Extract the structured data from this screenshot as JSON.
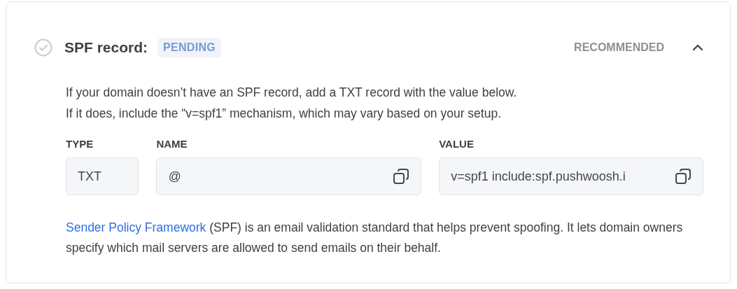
{
  "record": {
    "title": "SPF record:",
    "status": "PENDING",
    "verified": false,
    "tag": "RECOMMENDED",
    "expanded": true
  },
  "description": [
    "If your domain doesn’t have an SPF record, add a TXT record with the value below.",
    "If it does, include the “v=spf1” mechanism, which may vary based on your setup."
  ],
  "fields": [
    {
      "label": "TYPE",
      "value": "TXT",
      "kind": "plain"
    },
    {
      "label": "NAME",
      "value": "@",
      "kind": "copy"
    },
    {
      "label": "VALUE",
      "value": "v=spf1 include:spf.pushwoosh.i",
      "kind": "copy"
    }
  ],
  "footer": {
    "link": "Sender Policy Framework",
    "text": " (SPF) is an email validation standard that helps prevent spoofing. It lets domain owners specify which mail servers are allowed to send emails on their behalf."
  }
}
